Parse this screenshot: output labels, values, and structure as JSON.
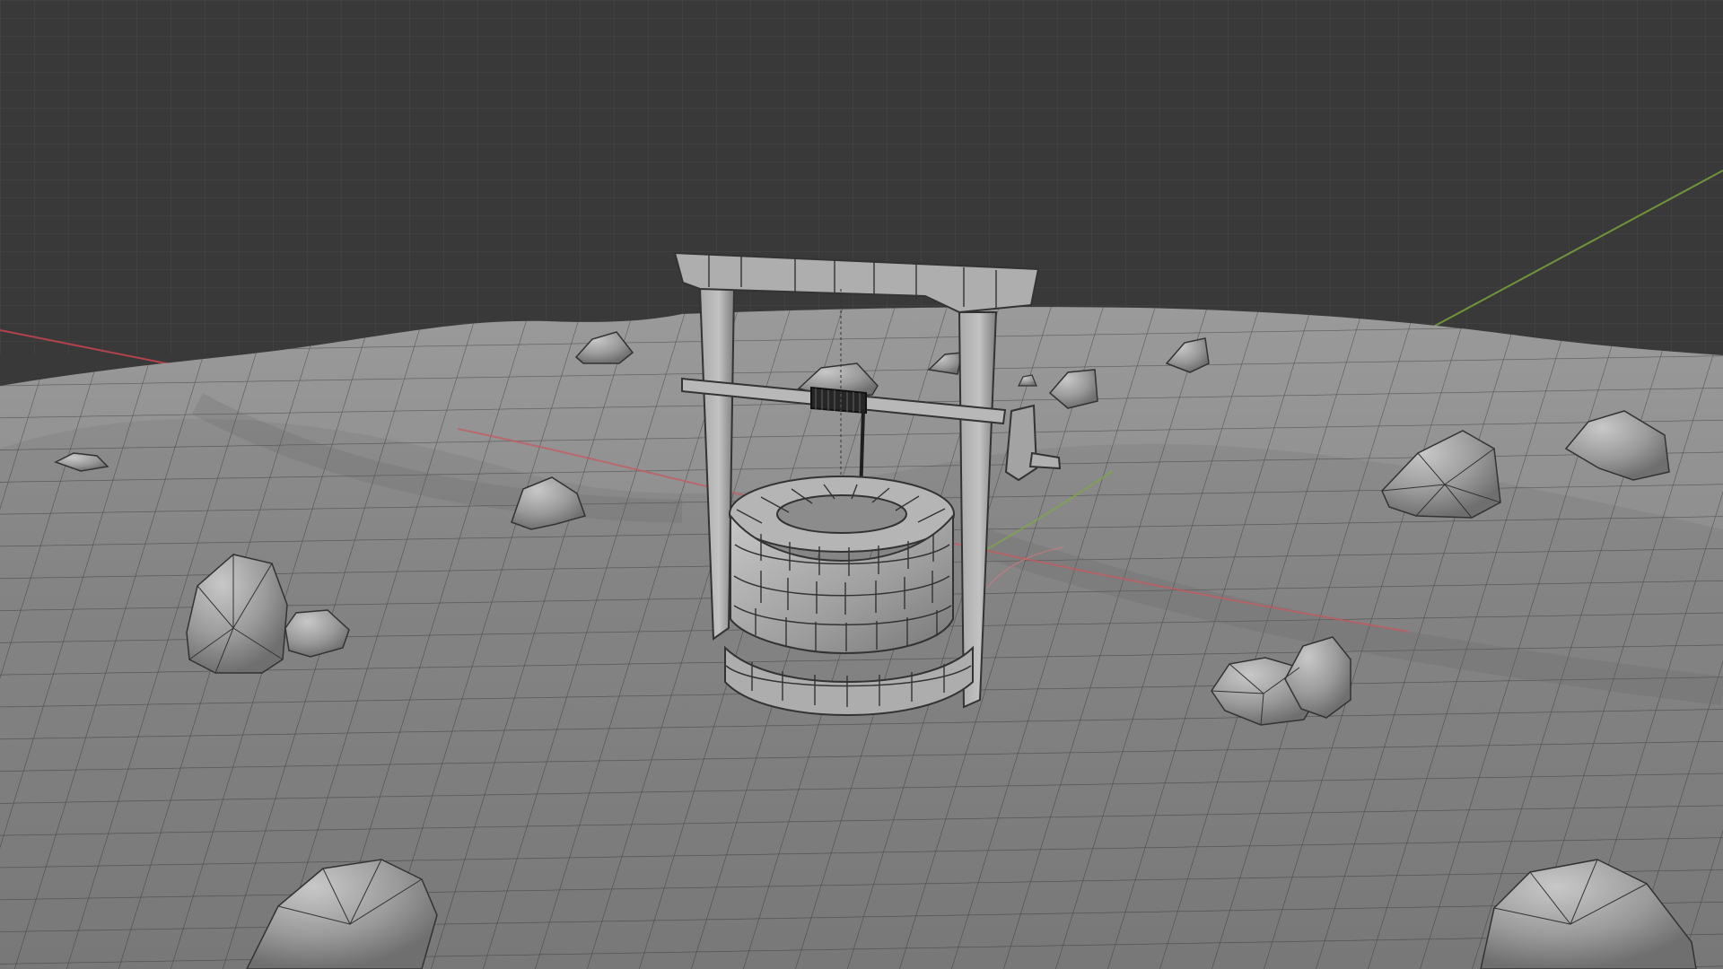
{
  "viewport": {
    "mode": "3d-viewport",
    "shading": "solid-wireframe",
    "colors": {
      "background": "#393939",
      "grid": "#4a4a4a",
      "ground": "#8d8d8d",
      "ground_wire": "#313131",
      "x_axis": "#c9474d",
      "y_axis": "#82b13c"
    }
  },
  "scene": {
    "objects": [
      "ground-plane",
      "stone-well",
      "well-roof-beam",
      "well-posts",
      "crank-axle",
      "rope-spool",
      "rope",
      "rocks"
    ]
  }
}
